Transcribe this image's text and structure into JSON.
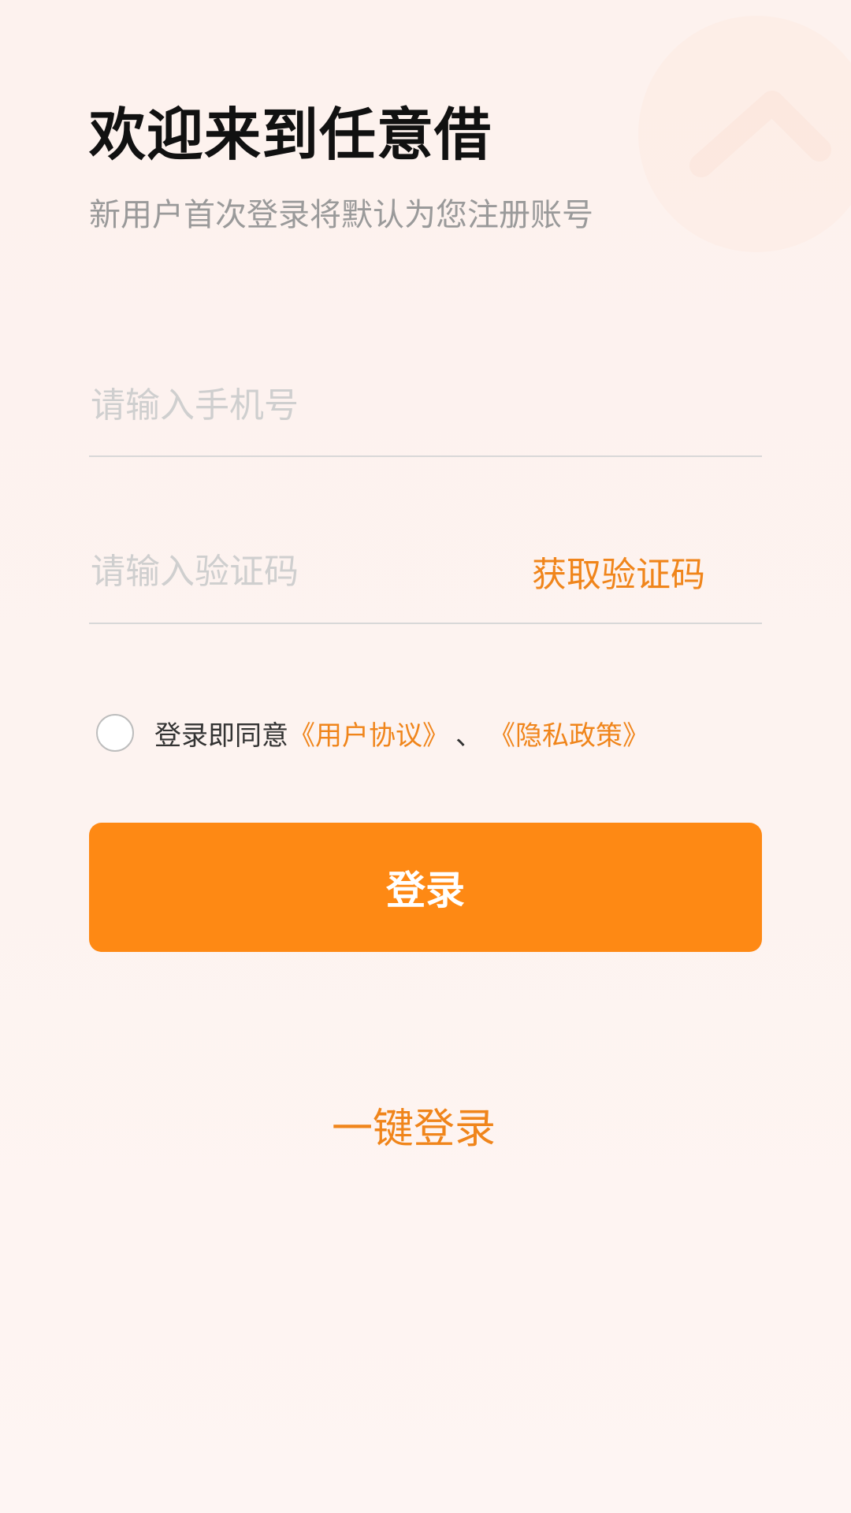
{
  "header": {
    "title": "欢迎来到任意借",
    "subtitle": "新用户首次登录将默认为您注册账号"
  },
  "form": {
    "phone_placeholder": "请输入手机号",
    "code_placeholder": "请输入验证码",
    "get_code_label": "获取验证码"
  },
  "agreement": {
    "prefix": "登录即同意",
    "user_agreement": "《用户协议》",
    "separator": "、",
    "privacy_policy": "《隐私政策》",
    "checked": false
  },
  "actions": {
    "login_label": "登录",
    "one_key_login_label": "一键登录"
  },
  "colors": {
    "accent": "#fe8914",
    "link": "#f0851b",
    "background": "#fdf3f0"
  },
  "icons": {
    "decoration": "logo-watermark-icon",
    "checkbox": "radio-circle-icon"
  }
}
